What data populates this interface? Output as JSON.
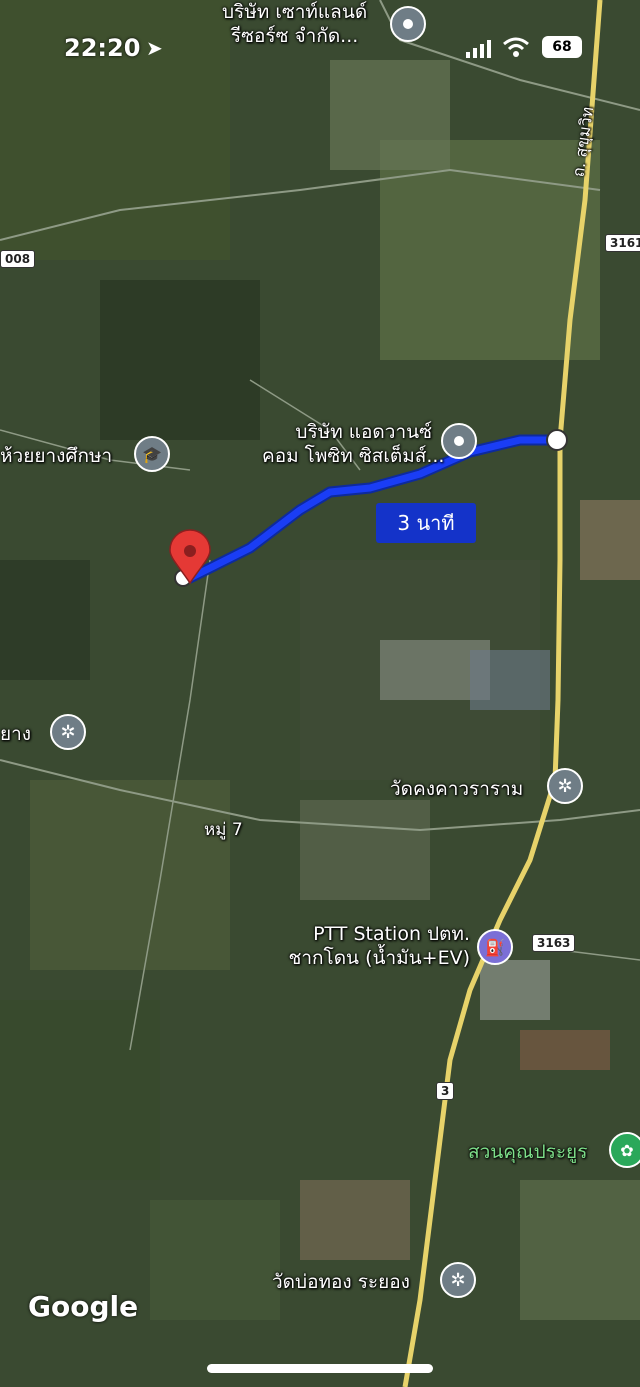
{
  "status_bar": {
    "time": "22:20",
    "battery": "68"
  },
  "route": {
    "eta_label": "3 นาที"
  },
  "places": {
    "south_land": {
      "line1": "บริษัท เซาท์แลนด์",
      "line2": "รีซอร์ซ จำกัด...",
      "icon": "place-pin-icon"
    },
    "advance_composite": {
      "line1": "บริษัท แอดวานซ์",
      "line2": "คอม โพซิท ซิสเต็มส์...",
      "icon": "place-pin-icon"
    },
    "school": {
      "label": "ห้วยยางศึกษา",
      "icon": "graduation-cap-icon"
    },
    "left_temple": {
      "label": "ยาง",
      "icon": "temple-icon"
    },
    "wat_khong": {
      "label": "วัดคงคาวราราม",
      "icon": "temple-icon"
    },
    "moo7": {
      "label": "หมู่ 7"
    },
    "ptt": {
      "line1": "PTT Station ปตท.",
      "line2": "ชากโดน (น้ำมัน+EV)",
      "icon": "fuel-station-icon"
    },
    "suan": {
      "label": "สวนคุณประยูร",
      "icon": "flower-icon"
    },
    "wat_bo_thong": {
      "label": "วัดบ่อทอง ระยอง",
      "icon": "temple-icon"
    },
    "sukhumvit": {
      "label": "ถ. สุขุมวิท"
    }
  },
  "roads": {
    "r3161": "3161",
    "r3163": "3163",
    "r3": "3",
    "r008": "008"
  },
  "map_brand": "Google",
  "colors": {
    "route": "#1a3df5",
    "destination_pin": "#e53935",
    "main_road": "#e7d36a"
  }
}
